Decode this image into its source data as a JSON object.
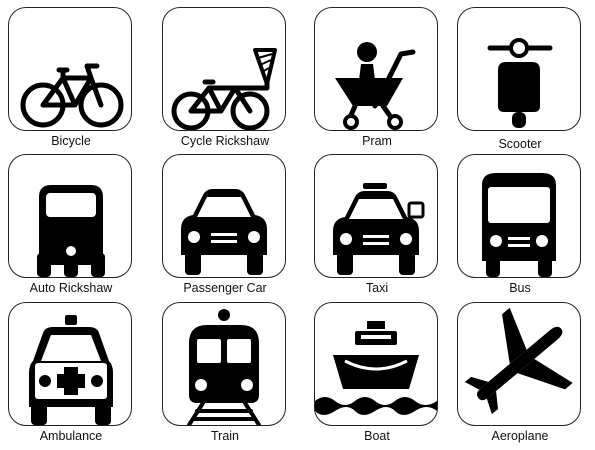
{
  "icons": [
    {
      "label": "Bicycle",
      "icon": "bicycle-icon"
    },
    {
      "label": "Cycle Rickshaw",
      "icon": "cycle-rickshaw-icon"
    },
    {
      "label": "Pram",
      "icon": "pram-icon"
    },
    {
      "label": "Scooter",
      "icon": "scooter-icon"
    },
    {
      "label": "Auto Rickshaw",
      "icon": "auto-rickshaw-icon"
    },
    {
      "label": "Passenger Car",
      "icon": "passenger-car-icon"
    },
    {
      "label": "Taxi",
      "icon": "taxi-icon"
    },
    {
      "label": "Bus",
      "icon": "bus-icon"
    },
    {
      "label": "Ambulance",
      "icon": "ambulance-icon"
    },
    {
      "label": "Train",
      "icon": "train-icon"
    },
    {
      "label": "Boat",
      "icon": "boat-icon"
    },
    {
      "label": "Aeroplane",
      "icon": "aeroplane-icon"
    }
  ],
  "colors": {
    "icon": "#000000",
    "border": "#222222",
    "background": "#ffffff"
  }
}
